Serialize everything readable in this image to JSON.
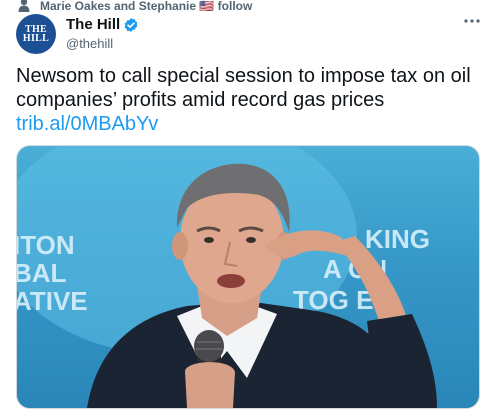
{
  "social_context": {
    "text": "Marie Oakes and Stephanie 🇺🇸 follow",
    "icon": "person-icon"
  },
  "author": {
    "avatar_lines": [
      "THE",
      "HILL"
    ],
    "display_name": "The Hill",
    "verified": true,
    "handle": "@thehill"
  },
  "tweet": {
    "text": "Newsom to call special session to impose tax on oil companies’ profits amid record gas prices",
    "link": "trib.al/0MBAbYv"
  },
  "media": {
    "description": "photo",
    "backdrop_left_lines": [
      "ITON",
      "BAL",
      "ATIVE"
    ],
    "backdrop_right_lines": [
      "KING",
      "A   ON",
      "TOG   ER"
    ]
  },
  "colors": {
    "link": "#1d9bf0",
    "verified": "#1d9bf0",
    "secondary_text": "#536471",
    "avatar_bg": "#1d4f94"
  }
}
